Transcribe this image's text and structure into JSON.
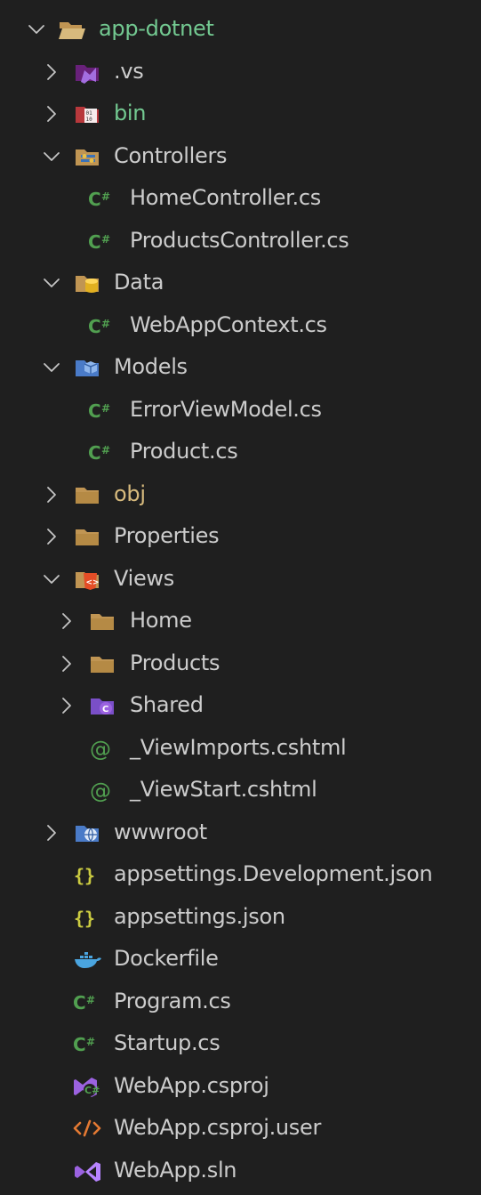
{
  "explorer": {
    "items": [
      {
        "label": "app-dotnet",
        "depth": 0,
        "chevron": "down",
        "icon": "folder-open-icon",
        "color": "green"
      },
      {
        "label": ".vs",
        "depth": 1,
        "chevron": "right",
        "icon": "visual-studio-folder-icon",
        "color": ""
      },
      {
        "label": "bin",
        "depth": 1,
        "chevron": "right",
        "icon": "binary-folder-icon",
        "color": "green"
      },
      {
        "label": "Controllers",
        "depth": 1,
        "chevron": "down",
        "icon": "controllers-folder-icon",
        "color": ""
      },
      {
        "label": "HomeController.cs",
        "depth": 2,
        "chevron": "",
        "icon": "csharp-icon",
        "color": ""
      },
      {
        "label": "ProductsController.cs",
        "depth": 2,
        "chevron": "",
        "icon": "csharp-icon",
        "color": ""
      },
      {
        "label": "Data",
        "depth": 1,
        "chevron": "down",
        "icon": "database-folder-icon",
        "color": ""
      },
      {
        "label": "WebAppContext.cs",
        "depth": 2,
        "chevron": "",
        "icon": "csharp-icon",
        "color": ""
      },
      {
        "label": "Models",
        "depth": 1,
        "chevron": "down",
        "icon": "models-folder-icon",
        "color": ""
      },
      {
        "label": "ErrorViewModel.cs",
        "depth": 2,
        "chevron": "",
        "icon": "csharp-icon",
        "color": ""
      },
      {
        "label": "Product.cs",
        "depth": 2,
        "chevron": "",
        "icon": "csharp-icon",
        "color": ""
      },
      {
        "label": "obj",
        "depth": 1,
        "chevron": "right",
        "icon": "folder-icon",
        "color": "tan"
      },
      {
        "label": "Properties",
        "depth": 1,
        "chevron": "right",
        "icon": "folder-icon",
        "color": ""
      },
      {
        "label": "Views",
        "depth": 1,
        "chevron": "down",
        "icon": "views-folder-icon",
        "color": ""
      },
      {
        "label": "Home",
        "depth": 2,
        "chevron": "right",
        "icon": "folder-icon",
        "color": ""
      },
      {
        "label": "Products",
        "depth": 2,
        "chevron": "right",
        "icon": "folder-icon",
        "color": ""
      },
      {
        "label": "Shared",
        "depth": 2,
        "chevron": "right",
        "icon": "shared-folder-icon",
        "color": ""
      },
      {
        "label": "_ViewImports.cshtml",
        "depth": 2,
        "chevron": "",
        "icon": "razor-icon",
        "color": ""
      },
      {
        "label": "_ViewStart.cshtml",
        "depth": 2,
        "chevron": "",
        "icon": "razor-icon",
        "color": ""
      },
      {
        "label": "wwwroot",
        "depth": 1,
        "chevron": "right",
        "icon": "web-folder-icon",
        "color": ""
      },
      {
        "label": "appsettings.Development.json",
        "depth": 1,
        "chevron": "",
        "icon": "json-icon",
        "color": ""
      },
      {
        "label": "appsettings.json",
        "depth": 1,
        "chevron": "",
        "icon": "json-icon",
        "color": ""
      },
      {
        "label": "Dockerfile",
        "depth": 1,
        "chevron": "",
        "icon": "docker-icon",
        "color": ""
      },
      {
        "label": "Program.cs",
        "depth": 1,
        "chevron": "",
        "icon": "csharp-icon",
        "color": ""
      },
      {
        "label": "Startup.cs",
        "depth": 1,
        "chevron": "",
        "icon": "csharp-icon",
        "color": ""
      },
      {
        "label": "WebApp.csproj",
        "depth": 1,
        "chevron": "",
        "icon": "csproj-icon",
        "color": ""
      },
      {
        "label": "WebApp.csproj.user",
        "depth": 1,
        "chevron": "",
        "icon": "xml-icon",
        "color": ""
      },
      {
        "label": "WebApp.sln",
        "depth": 1,
        "chevron": "",
        "icon": "solution-icon",
        "color": ""
      }
    ]
  },
  "colors": {
    "background": "#1f1f1f",
    "text": "#cccccc",
    "untracked_green": "#73c991",
    "modified_tan": "#d7ba7d",
    "csharp_green": "#519f50",
    "folder_tan": "#c09553",
    "json_yellow": "#cbcb41",
    "xml_orange": "#e37933",
    "vs_purple": "#9b62e0"
  }
}
